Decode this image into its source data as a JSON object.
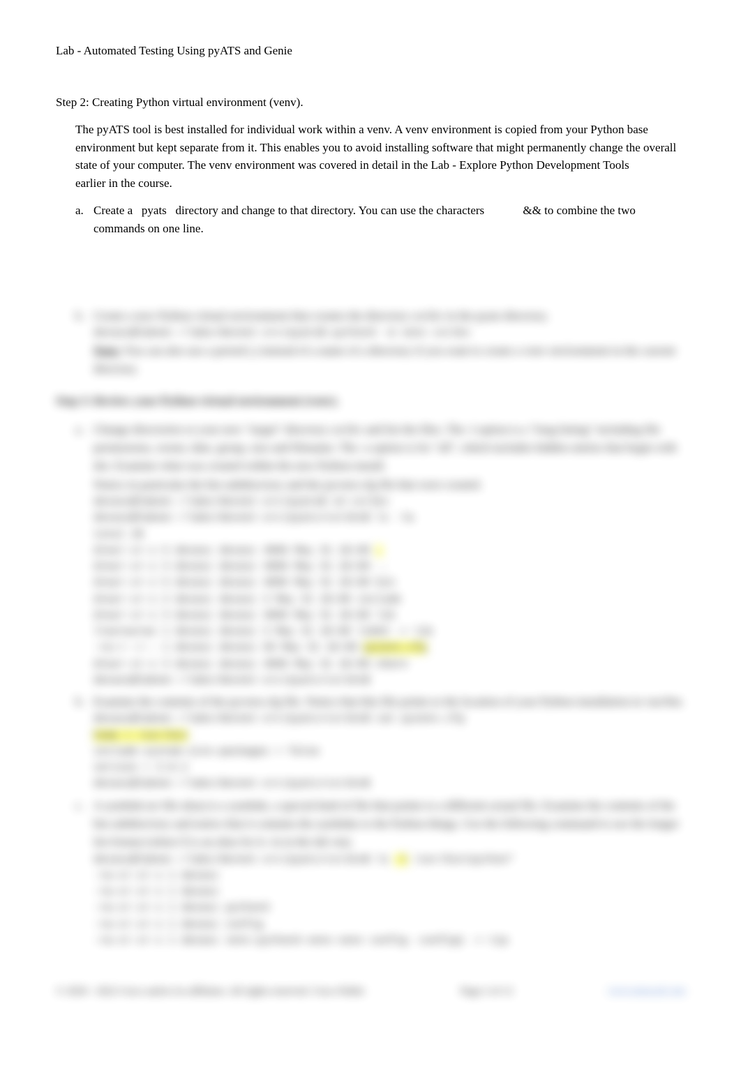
{
  "title": "Lab - Automated Testing Using pyATS and Genie",
  "step2": {
    "heading": "Step 2: Creating Python virtual environment (venv).",
    "intro": "The pyATS tool is best installed for individual work within a venv. A venv environment is copied from your Python base environment but kept separate from it. This enables you to avoid installing software that might permanently change the overall state of your computer. The venv environment was covered in detail in the Lab - Explore Python Development Tools         earlier in the course.",
    "a_marker": "a.",
    "a_1": "Create a",
    "a_2": "pyats",
    "a_3": "directory and change to that directory. You can use the characters",
    "a_4": "&& to combine the two commands on one line."
  },
  "blur": {
    "b_marker": "b.",
    "b_text": "Create a new Python virtual environment that creates the directory csr1kv in the pyats directory.",
    "b_cmd": "devasc@labvm:~/labs/devnet-src/pyats$ python3 -m venv csr1kv",
    "note_label": "Note:",
    "note_text": "You can also use a period (.) instead of a name of a directory if you want to create a venv environment in the current directory.",
    "step3_heading": "Step 3: Review your Python virtual environment (venv).",
    "a_marker": "a.",
    "a_p1": "Change directories to your new \"target\" directory csr1kv and list the files. The -l option is a \"long listing\" including file permissions, owner, date, group, size and filename. The -a option is for \"all\", which includes hidden entries that begin with dot. Examine what was created within the new Python install.",
    "a_p2": "Notice in particular the bin subdirectory and the pyvenv.cfg file that were created.",
    "a_cmd1": "devasc@labvm:~/labs/devnet-src/pyats$ cd csr1kv",
    "a_cmd2": "devasc@labvm:~/labs/devnet-src/pyats/csr1kv$ ls -la",
    "a_ls_total": "total 20",
    "a_ls1_a": "drwxr-xr-x 5 devasc devasc 4096 May 31 18:09",
    "a_ls1_b": ".",
    "a_ls2": "drwxr-xr-x 3 devasc devasc 4096 May 31 18:09 ..",
    "a_ls3_a": "drwxr-xr-x 5 devasc devasc 4096 May 31 18:09",
    "a_ls3_b": "bin",
    "a_ls4": "drwxr-xr-x 2 devasc devasc    3 May 31 18:09 include",
    "a_ls5": "drwxr-xr-x 3 devasc devasc 4096 May 31 18:09 lib",
    "a_ls6_a": "lrwxrwxrwx 1 devasc devasc    3 May 31 18:09 lib64 -> lib",
    "a_ls7_a": "-rw-r--r-- 1 devasc devasc   69 May 31 18:09",
    "a_ls7_b": "pyvenv.cfg",
    "a_ls8": "drwxr-xr-x 3 devasc devasc 4096 May 31 18:09 share",
    "a_end": "devasc@labvm:~/labs/devnet-src/pyats/csr1kv$",
    "b2_marker": "b.",
    "b2_text": "Examine the contents of the pyvenv.cfg file. Notice that this file points to the location of your Python installation in /usr/bin.",
    "b2_cmd": "devasc@labvm:~/labs/devnet-src/pyats/csr1kv$ cat pyvenv.cfg",
    "b2_out1": "home = /usr/bin",
    "b2_out2": "include-system-site-packages = false",
    "b2_out3": "version = 3.8.2",
    "b2_end": "devasc@labvm:~/labs/devnet-src/pyats/csr1kv$",
    "c_marker": "c.",
    "c_text": "A symlink (or file alias) is a symlink, a special kind of file that points to a different actual file. Examine the contents of the bin subdirectory and notice that it contains the symlinks to the Python things. Use the following command to see the longer list format (where ll is an alias for ls -la in the lab vm).",
    "c_cmd_a": "devasc@labvm:~/labs/devnet-src/pyats/csr1kv$ ls",
    "c_cmd_b": "-l",
    "c_cmd_c": "/usr/bin/python*",
    "c_out1": "-rw-xr-xr-x 1 devasc",
    "c_out2": "-rw-xr-xr-x 1 devasc",
    "c_out3": "-rw-xr-xr-x 1 devasc python3",
    "c_out4": "-rw-xr-xr-x 1 devasc config",
    "c_out5": "-rw-xr-xr-x 1 devasc venv-python3-venv-venv config -config1 -> tip"
  },
  "footer": {
    "left": "© 2020 - 2022 Cisco and/or its affiliates. All rights reserved. Cisco Public",
    "center": "Page 2 of 12",
    "right": "www.netacad.com"
  }
}
